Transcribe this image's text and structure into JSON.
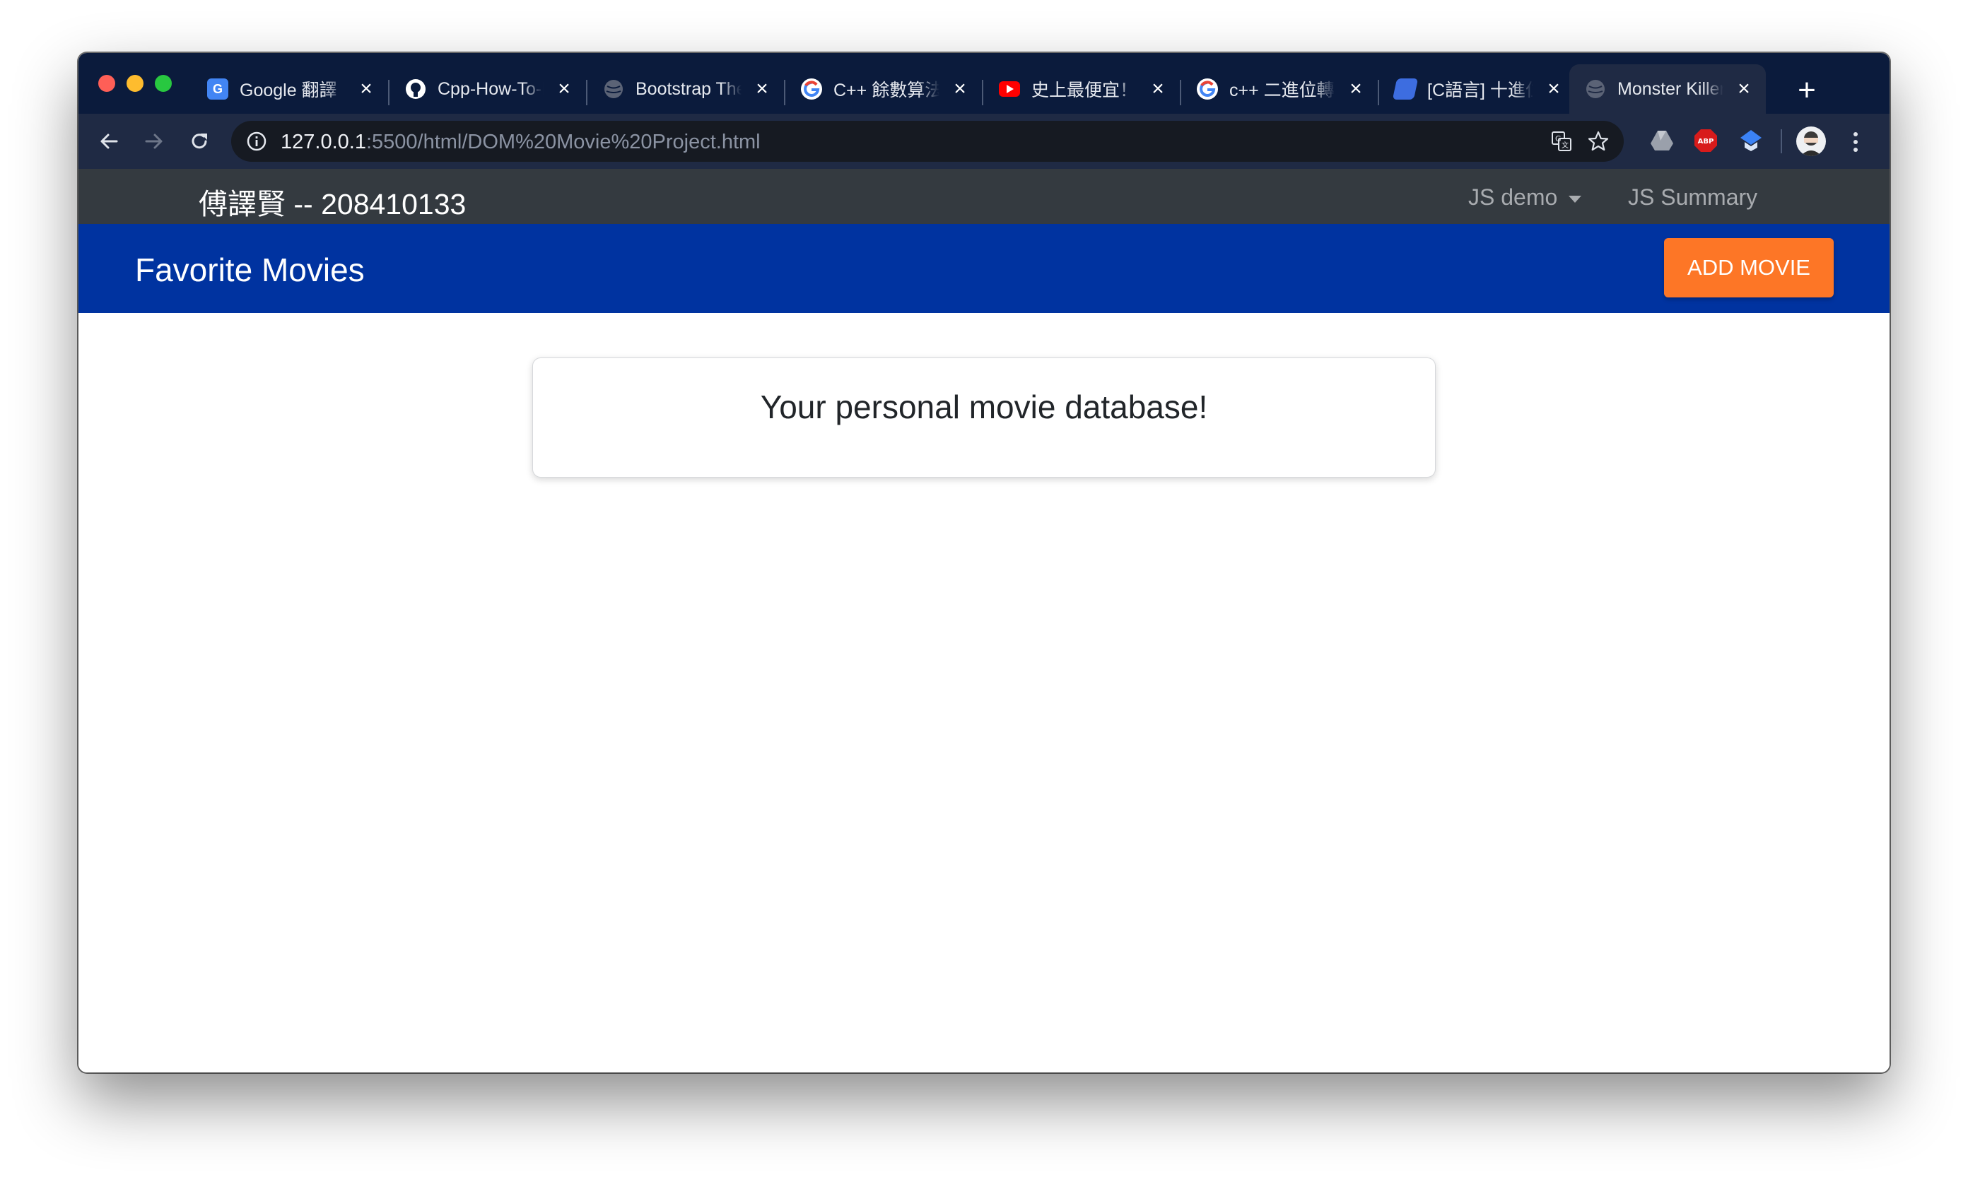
{
  "browser": {
    "tabs": [
      {
        "title": "Google 翻譯",
        "icon": "google-translate-icon"
      },
      {
        "title": "Cpp-How-To-Program",
        "icon": "github-icon"
      },
      {
        "title": "Bootstrap Themes",
        "icon": "globe-icon"
      },
      {
        "title": "C++ 餘數算法",
        "icon": "google-icon"
      },
      {
        "title": "史上最便宜！",
        "icon": "youtube-icon"
      },
      {
        "title": "c++ 二進位轉換",
        "icon": "google-icon"
      },
      {
        "title": "[C語言] 十進位",
        "icon": "book-icon"
      },
      {
        "title": "Monster Killer",
        "icon": "globe-icon",
        "active": true
      }
    ],
    "url_host": "127.0.0.1",
    "url_path": ":5500/html/DOM%20Movie%20Project.html"
  },
  "navbar": {
    "brand": "傅譯賢 -- 208410133",
    "links": [
      {
        "label": "JS demo",
        "dropdown": true
      },
      {
        "label": "JS Summary"
      }
    ]
  },
  "header": {
    "title": "Favorite Movies",
    "add_button": "ADD MOVIE"
  },
  "main": {
    "entry_text": "Your personal movie database!"
  },
  "colors": {
    "header_bg": "#0033a0",
    "accent": "#fd7626",
    "navbar_bg": "#343a40"
  }
}
